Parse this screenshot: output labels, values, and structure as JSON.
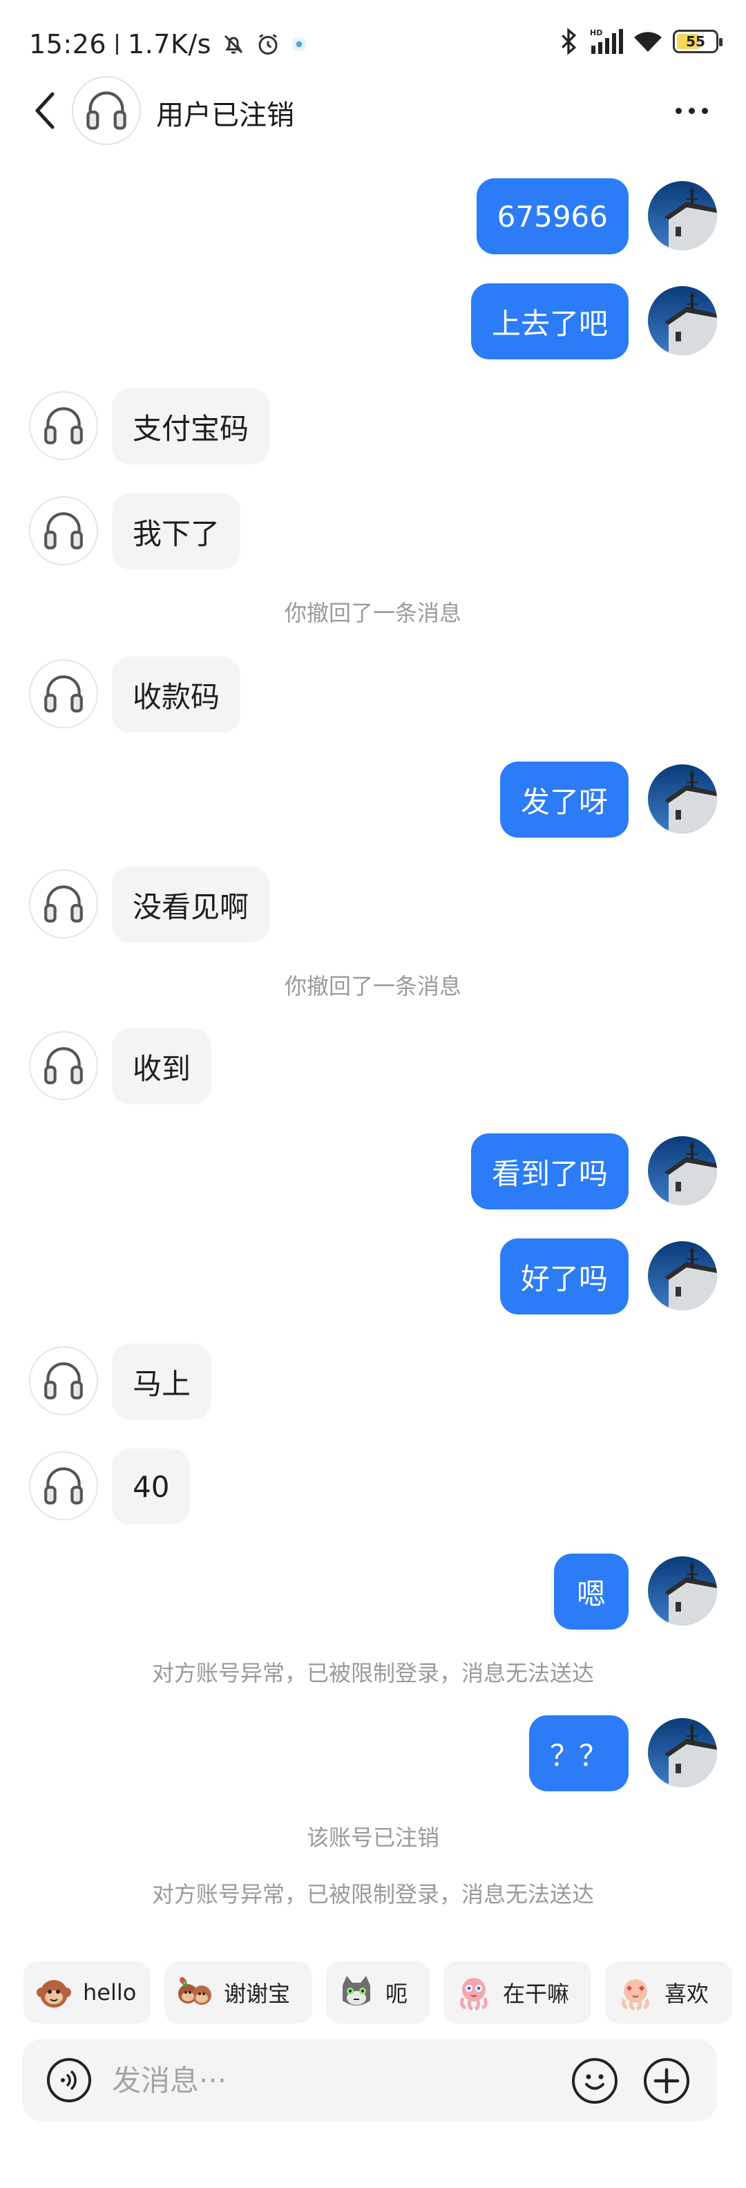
{
  "status_bar": {
    "time": "15:26",
    "speed": "1.7K/s",
    "battery": "55"
  },
  "header": {
    "title": "用户已注销"
  },
  "messages": [
    {
      "side": "self",
      "text": "675966"
    },
    {
      "side": "self",
      "text": "上去了吧"
    },
    {
      "side": "other",
      "text": "支付宝码"
    },
    {
      "side": "other",
      "text": "我下了"
    },
    {
      "side": "system",
      "text": "你撤回了一条消息"
    },
    {
      "side": "other",
      "text": "收款码"
    },
    {
      "side": "self",
      "text": "发了呀"
    },
    {
      "side": "other",
      "text": "没看见啊"
    },
    {
      "side": "system",
      "text": "你撤回了一条消息"
    },
    {
      "side": "other",
      "text": "收到"
    },
    {
      "side": "self",
      "text": "看到了吗"
    },
    {
      "side": "self",
      "text": "好了吗"
    },
    {
      "side": "other",
      "text": "马上"
    },
    {
      "side": "other",
      "text": "40"
    },
    {
      "side": "self",
      "text": "嗯"
    },
    {
      "side": "system",
      "text": "对方账号异常，已被限制登录，消息无法送达"
    },
    {
      "side": "self",
      "text": "？？"
    },
    {
      "side": "system",
      "text": "该账号已注销"
    },
    {
      "side": "system",
      "text": "对方账号异常，已被限制登录，消息无法送达"
    }
  ],
  "quick_emojis": [
    {
      "label": "hello",
      "icon": "monkey-hello-emoji"
    },
    {
      "label": "谢谢宝",
      "icon": "monkeys-thanks-emoji"
    },
    {
      "label": "呃",
      "icon": "cat-emoji"
    },
    {
      "label": "在干嘛",
      "icon": "octopus-emoji"
    },
    {
      "label": "喜欢",
      "icon": "octopus-love-emoji"
    }
  ],
  "input": {
    "placeholder": "发消息···"
  },
  "colors": {
    "self_bubble": "#2b7cf6",
    "other_bubble": "#f4f4f4",
    "system_text": "#9a9a9a"
  }
}
